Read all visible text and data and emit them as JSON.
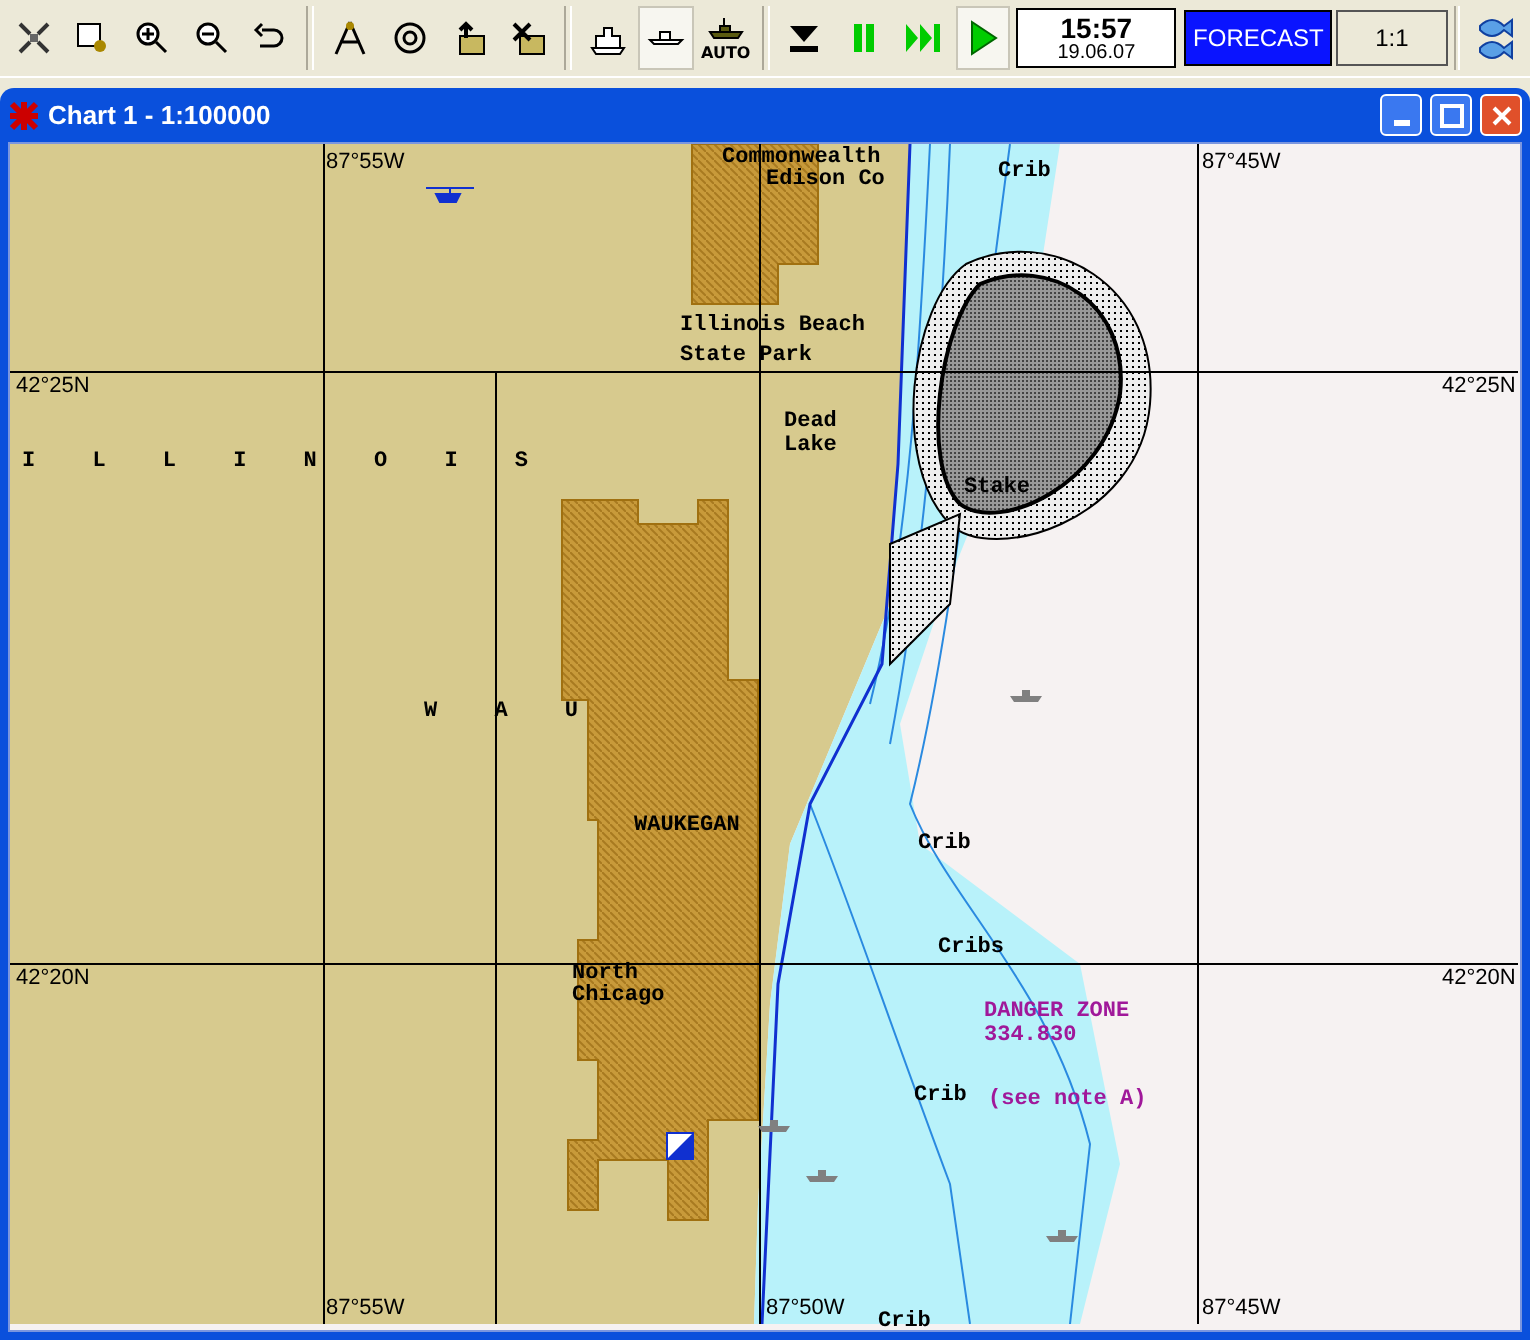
{
  "toolbar": {
    "tools": [
      {
        "pressed": false
      },
      {
        "pressed": false
      },
      {
        "pressed": false
      },
      {
        "pressed": false
      },
      {
        "pressed": false
      },
      {
        "pressed": false
      },
      {
        "pressed": false
      },
      {
        "pressed": false
      },
      {
        "pressed": false
      },
      {
        "pressed": false
      },
      {
        "pressed": true
      },
      {
        "pressed": false,
        "label": "AUTO"
      }
    ],
    "playback": [
      {
        "pressed": false
      },
      {
        "pressed": false
      },
      {
        "pressed": false
      },
      {
        "pressed": true
      }
    ],
    "clock": {
      "time": "15:57",
      "date": "19.06.07"
    },
    "mode": {
      "label": "FORECAST",
      "active": true
    },
    "scale": {
      "label": "1:1"
    }
  },
  "window": {
    "title": "Chart 1 - 1:100000"
  },
  "chart_labels": [
    {
      "text": "87°55W",
      "kind": "grid"
    },
    {
      "text": "Commonwealth",
      "kind": "place"
    },
    {
      "text": "Edison Co",
      "kind": "place"
    },
    {
      "text": "Crib",
      "kind": "place"
    },
    {
      "text": "87°45W",
      "kind": "grid"
    },
    {
      "text": "Illinois Beach",
      "kind": "place"
    },
    {
      "text": "State Park",
      "kind": "place"
    },
    {
      "text": "42°25N",
      "kind": "grid"
    },
    {
      "text": "42°25N",
      "kind": "grid"
    },
    {
      "text": "Dead",
      "kind": "place"
    },
    {
      "text": "Lake",
      "kind": "place"
    },
    {
      "text": "I L L I N O I S",
      "kind": "spaced"
    },
    {
      "text": "Stake",
      "kind": "place"
    },
    {
      "text": "W A U",
      "kind": "spaced"
    },
    {
      "text": "WAUKEGAN",
      "kind": "place"
    },
    {
      "text": "Crib",
      "kind": "place"
    },
    {
      "text": "Cribs",
      "kind": "place"
    },
    {
      "text": "42°20N",
      "kind": "grid"
    },
    {
      "text": "North",
      "kind": "place"
    },
    {
      "text": "42°20N",
      "kind": "grid"
    },
    {
      "text": "Chicago",
      "kind": "place"
    },
    {
      "text": "DANGER ZONE",
      "kind": "danger"
    },
    {
      "text": "334.830",
      "kind": "danger"
    },
    {
      "text": "Crib",
      "kind": "place"
    },
    {
      "text": "(see note A)",
      "kind": "danger"
    },
    {
      "text": "87°55W",
      "kind": "grid"
    },
    {
      "text": "87°50W",
      "kind": "grid"
    },
    {
      "text": "87°45W",
      "kind": "grid"
    },
    {
      "text": "Crib",
      "kind": "place"
    }
  ]
}
